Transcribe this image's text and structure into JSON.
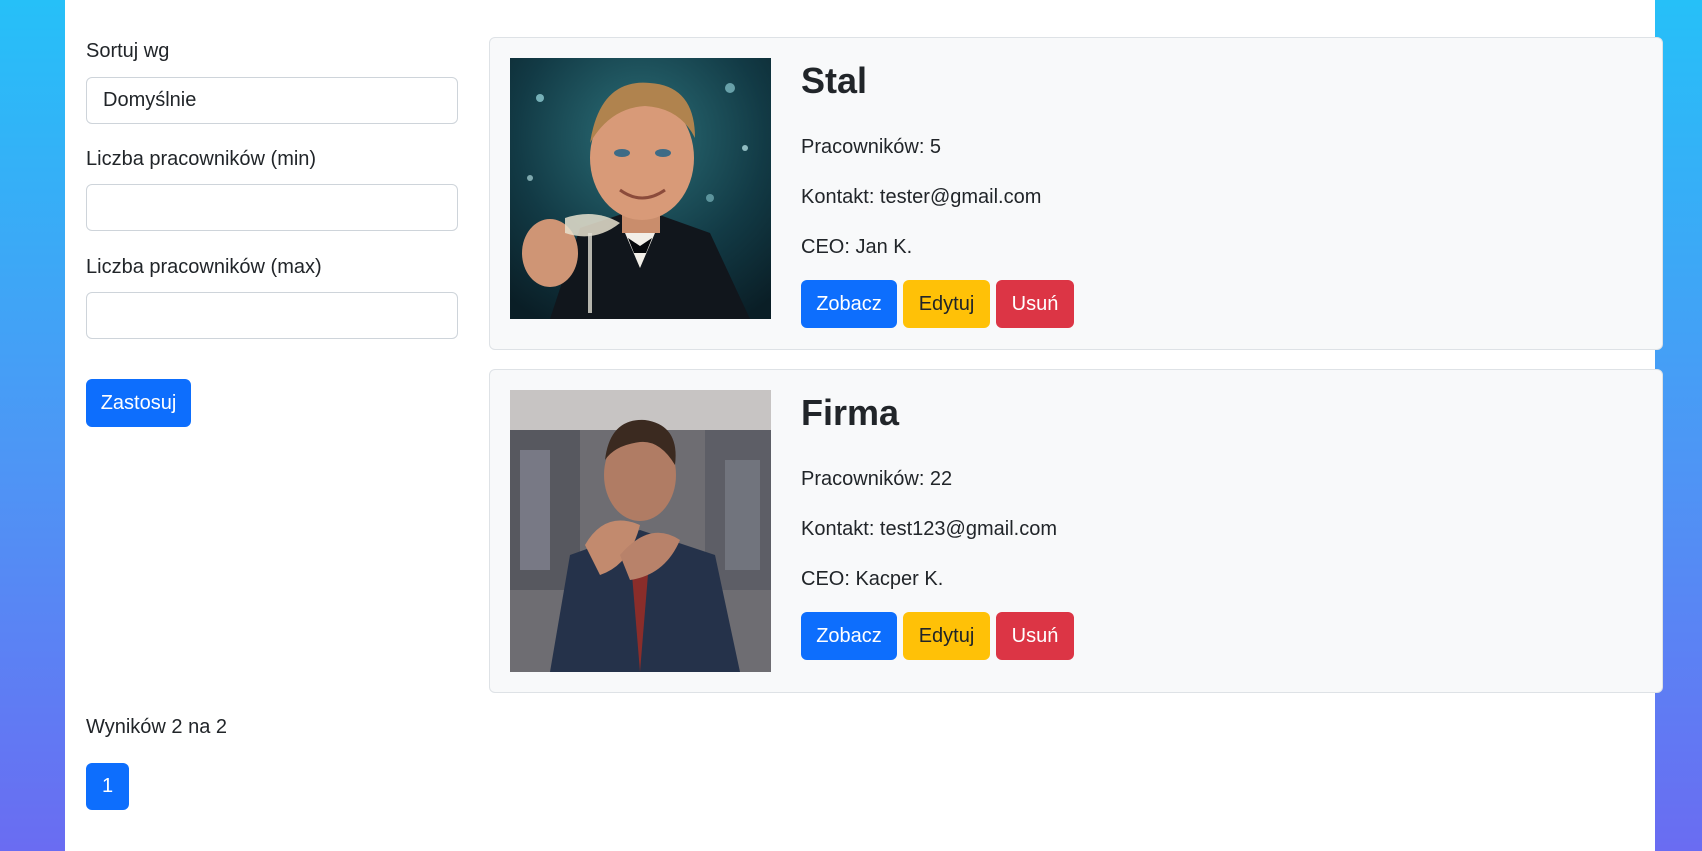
{
  "filters": {
    "sort_label": "Sortuj wg",
    "sort_value": "Domyślnie",
    "min_label": "Liczba pracowników (min)",
    "min_value": "",
    "max_label": "Liczba pracowników (max)",
    "max_value": "",
    "apply_label": "Zastosuj"
  },
  "companies": [
    {
      "name": "Stal",
      "employees": "Pracowników: 5",
      "contact": "Kontakt: tester@gmail.com",
      "ceo": "CEO: Jan K.",
      "image_icon": "toasting-man-photo",
      "view_label": "Zobacz",
      "edit_label": "Edytuj",
      "delete_label": "Usuń"
    },
    {
      "name": "Firma",
      "employees": "Pracowników: 22",
      "contact": "Kontakt: test123@gmail.com",
      "ceo": "CEO: Kacper K.",
      "image_icon": "clapping-man-photo",
      "view_label": "Zobacz",
      "edit_label": "Edytuj",
      "delete_label": "Usuń"
    }
  ],
  "pagination": {
    "summary": "Wyników 2 na 2",
    "current_page": "1"
  },
  "colors": {
    "primary": "#0d6efd",
    "warning": "#ffc107",
    "danger": "#dc3545",
    "card_bg": "#f8f9fa"
  }
}
